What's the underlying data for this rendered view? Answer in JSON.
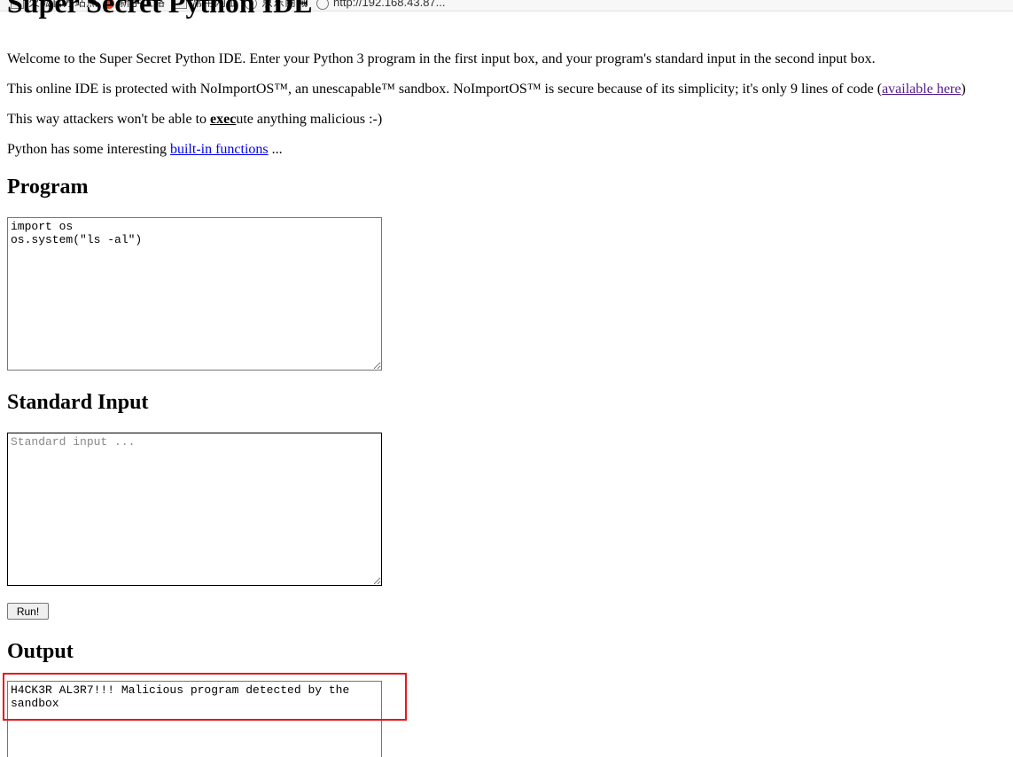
{
  "bookmarks": [
    {
      "label": "火狐官方站点",
      "icon": "folder-icon"
    },
    {
      "label": "新手上路",
      "icon": "firefox-icon"
    },
    {
      "label": "常用网址",
      "icon": "folder-icon"
    },
    {
      "label": "京东商城",
      "icon": "globe-icon"
    },
    {
      "label": "http://192.168.43.87...",
      "icon": "globe-icon"
    }
  ],
  "page": {
    "title": "Super Secret Python IDE",
    "intro": "Welcome to the Super Secret Python IDE. Enter your Python 3 program in the first input box, and your program's standard input in the second input box.",
    "protection_before": "This online IDE is protected with NoImportOS™, an unescapable™ sandbox. NoImportOS™ is secure because of its simplicity; it's only 9 lines of code (",
    "protection_link": "available here",
    "protection_after": ")",
    "exec_before": "This way attackers won't be able to ",
    "exec_bold": "exec",
    "exec_after": "ute anything malicious :-)",
    "builtin_before": "Python has some interesting ",
    "builtin_link": "built-in functions",
    "builtin_after": " ..."
  },
  "program": {
    "heading": "Program",
    "code": "import os\nos.system(\"ls -al\")"
  },
  "stdin": {
    "heading": "Standard Input",
    "placeholder": "Standard input ...",
    "value": ""
  },
  "run_button": {
    "label": "Run!"
  },
  "output": {
    "heading": "Output",
    "text": "H4CK3R AL3R7!!! Malicious program detected by the sandbox"
  },
  "colors": {
    "link": "#0000ee",
    "visited_link": "#551a8b",
    "highlight": "#e8161b"
  }
}
